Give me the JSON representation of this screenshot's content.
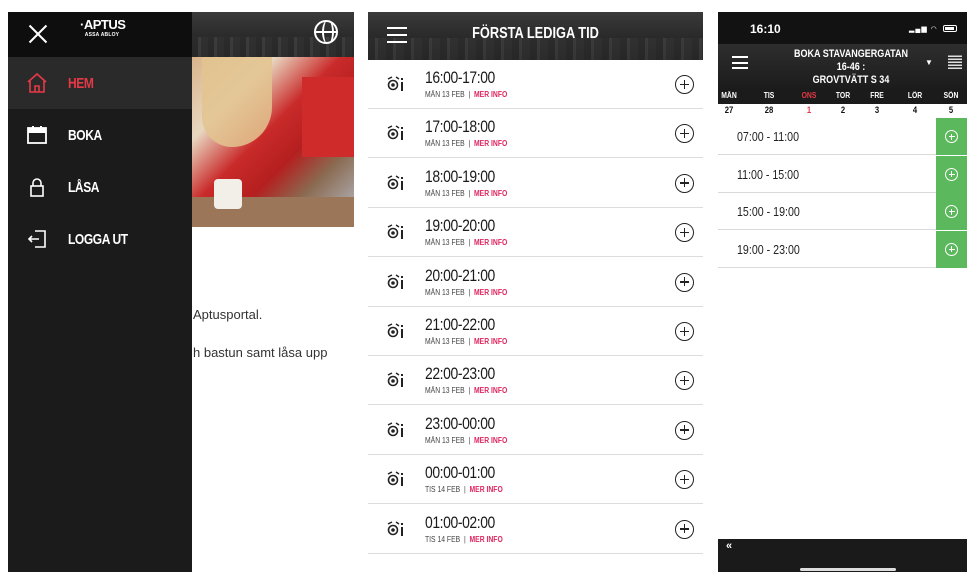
{
  "panel_menu": {
    "logo_line1": "·APTUS",
    "logo_line2": "ASSA ABLOY",
    "menu_items": [
      {
        "label": "HEM",
        "icon": "home-icon",
        "active": true
      },
      {
        "label": "BOKA",
        "icon": "calendar-icon",
        "active": false
      },
      {
        "label": "LÅSA",
        "icon": "lock-icon",
        "active": false
      },
      {
        "label": "LOGGA UT",
        "icon": "logout-icon",
        "active": false
      }
    ],
    "body_text_1": "Aptusportal.",
    "body_text_2": "h bastun samt låsa upp",
    "accent_color": "#e63946"
  },
  "panel_slots": {
    "title": "FÖRSTA LEDIGA TID",
    "separator": "|",
    "more_info": "MER INFO",
    "rows": [
      {
        "time": "16:00-17:00",
        "date": "MÅN 13 FEB"
      },
      {
        "time": "17:00-18:00",
        "date": "MÅN 13 FEB"
      },
      {
        "time": "18:00-19:00",
        "date": "MÅN 13 FEB"
      },
      {
        "time": "19:00-20:00",
        "date": "MÅN 13 FEB"
      },
      {
        "time": "20:00-21:00",
        "date": "MÅN 13 FEB"
      },
      {
        "time": "21:00-22:00",
        "date": "MÅN 13 FEB"
      },
      {
        "time": "22:00-23:00",
        "date": "MÅN 13 FEB"
      },
      {
        "time": "23:00-00:00",
        "date": "MÅN 13 FEB"
      },
      {
        "time": "00:00-01:00",
        "date": "TIS 14 FEB"
      },
      {
        "time": "01:00-02:00",
        "date": "TIS 14 FEB"
      }
    ]
  },
  "panel_booking": {
    "clock": "16:10",
    "title_line1": "BOKA STAVANGERGATAN 16-46 :",
    "title_line2": "GROVTVÄTT S 34",
    "weekdays": [
      "MÅN",
      "TIS",
      "ONS",
      "TOR",
      "FRE",
      "LÖR",
      "SÖN"
    ],
    "dates": [
      "27",
      "28",
      "1",
      "2",
      "3",
      "4",
      "5"
    ],
    "highlight_index": 2,
    "highlight_color": "#e63946",
    "slots": [
      "07:00 - 11:00",
      "11:00 - 15:00",
      "15:00 - 19:00",
      "19:00 - 23:00"
    ],
    "add_color": "#5cb85c",
    "back_label": "«"
  }
}
